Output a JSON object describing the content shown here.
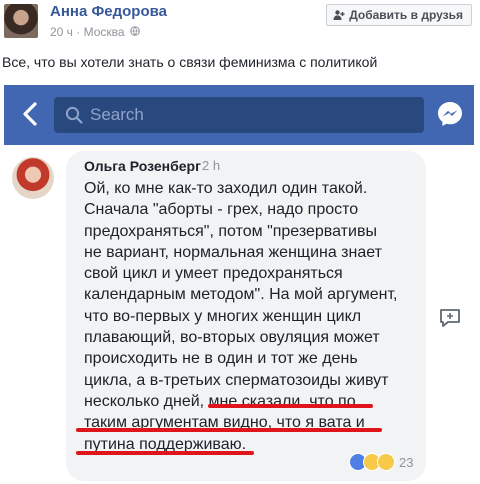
{
  "post": {
    "author": "Анна Федорова",
    "time": "20 ч",
    "separator": "·",
    "location": "Москва",
    "add_friend_label": "Добавить в друзья",
    "text": "Все, что вы хотели знать о связи феминизма с политикой"
  },
  "embed": {
    "search_placeholder": "Search",
    "comment": {
      "author": "Ольга Розенберг",
      "time": "2 h",
      "lines": [
        "Ой, ко мне как-то заходил один такой.",
        "Сначала \"аборты - грех, надо просто",
        "предохраняться\", потом \"презервативы",
        "не вариант, нормальная женщина знает",
        "свой цикл и умеет предохраняться",
        "календарным методом\". На мой аргумент,",
        "что во-первых у многих женщин цикл",
        "плавающий,  во-вторых овуляция может",
        "происходить не в один и тот же день",
        "цикла, а в-третьих сперматозоиды живут",
        "несколько дней, мне сказали, что по",
        "таким аргументам видно, что я вата и",
        "путина поддерживаю."
      ],
      "reaction_count": "23"
    }
  },
  "colors": {
    "nav_blue": "#4267b2",
    "search_bg": "#29487d",
    "link_blue": "#365899",
    "underline_red": "#e0141b",
    "bubble_gray": "#f2f3f5"
  },
  "icons": [
    "globe-icon",
    "add-friend-icon",
    "back-icon",
    "search-icon",
    "messenger-icon",
    "reply-icon",
    "like-icon",
    "haha-icon",
    "wow-icon"
  ]
}
